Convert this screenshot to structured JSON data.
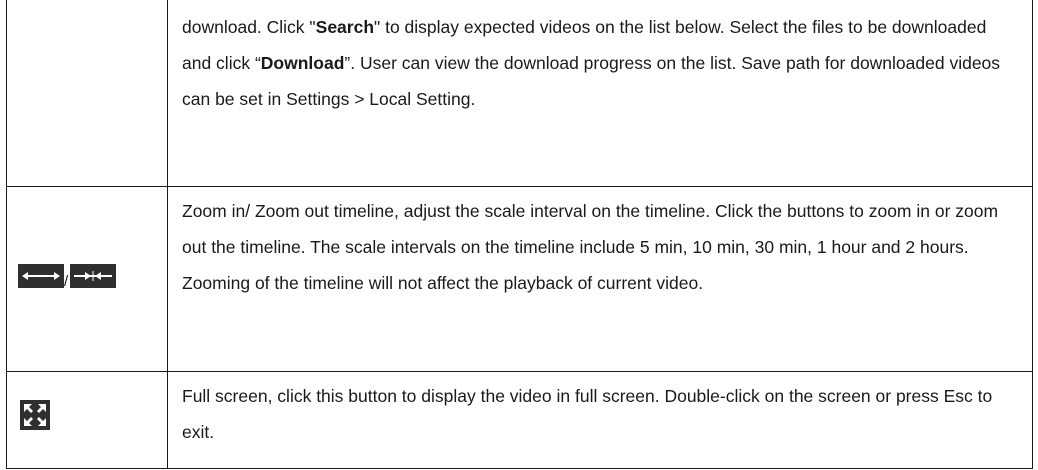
{
  "rows": [
    {
      "text_part1": "download. Click \"",
      "bold1": "Search",
      "text_part2": "\" to display expected videos on the list below. Select the files to be downloaded and click “",
      "bold2": "Download",
      "text_part3": "”. User can view the download progress on the list. Save path for downloaded videos can be set in Settings > Local Setting."
    },
    {
      "icon_left": "zoom-in-timeline-icon",
      "separator": "/",
      "icon_right": "zoom-out-timeline-icon",
      "text": "Zoom in/ Zoom out timeline, adjust the scale interval on the timeline. Click the buttons to zoom in or zoom out the timeline. The scale intervals on the timeline include 5 min, 10 min, 30 min, 1 hour and 2 hours. Zooming of the timeline will not affect the playback of current video."
    },
    {
      "icon": "fullscreen-icon",
      "text": "Full screen, click this button to display the video in full screen. Double-click on the screen or press Esc to exit."
    }
  ],
  "colors": {
    "icon_bg": "#2f2f2f",
    "icon_fg": "#ffffff",
    "border": "#1a1a1a"
  }
}
